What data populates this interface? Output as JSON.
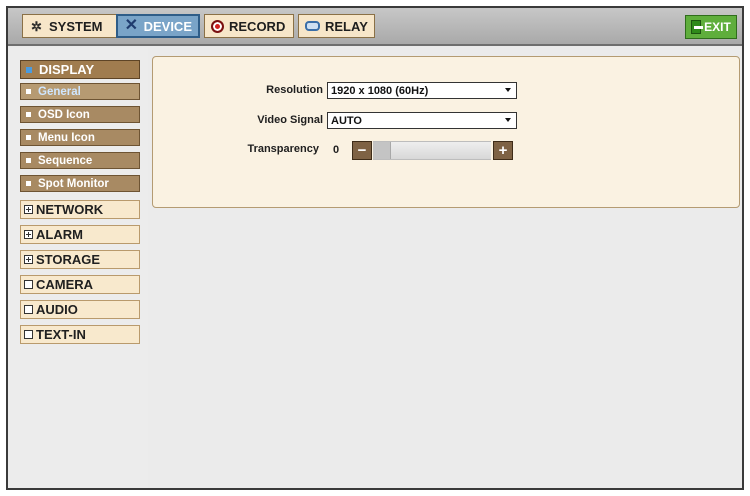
{
  "topbar": {
    "tabs": [
      {
        "label": "SYSTEM",
        "icon": "gear-icon"
      },
      {
        "label": "DEVICE",
        "icon": "tools-icon"
      },
      {
        "label": "RECORD",
        "icon": "record-icon"
      },
      {
        "label": "RELAY",
        "icon": "relay-icon"
      }
    ],
    "active_tab": "DEVICE",
    "exit_label": "EXIT"
  },
  "sidebar": {
    "display": {
      "label": "DISPLAY",
      "items": [
        "General",
        "OSD Icon",
        "Menu Icon",
        "Sequence",
        "Spot Monitor"
      ],
      "active_item": "General"
    },
    "groups": [
      {
        "label": "NETWORK",
        "expandable": true
      },
      {
        "label": "ALARM",
        "expandable": true
      },
      {
        "label": "STORAGE",
        "expandable": true
      },
      {
        "label": "CAMERA",
        "expandable": false
      },
      {
        "label": "AUDIO",
        "expandable": false
      },
      {
        "label": "TEXT-IN",
        "expandable": false
      }
    ]
  },
  "general": {
    "resolution": {
      "label": "Resolution",
      "value": "1920 x 1080 (60Hz)"
    },
    "video_signal": {
      "label": "Video Signal",
      "value": "AUTO"
    },
    "transparency": {
      "label": "Transparency",
      "value": "0",
      "minus": "−",
      "plus": "+"
    }
  },
  "colors": {
    "tab_active": "#7aa4c8",
    "sidebar_header": "#a07c4f",
    "exit_green": "#5fae3c",
    "panel_bg": "#faf2e2"
  }
}
